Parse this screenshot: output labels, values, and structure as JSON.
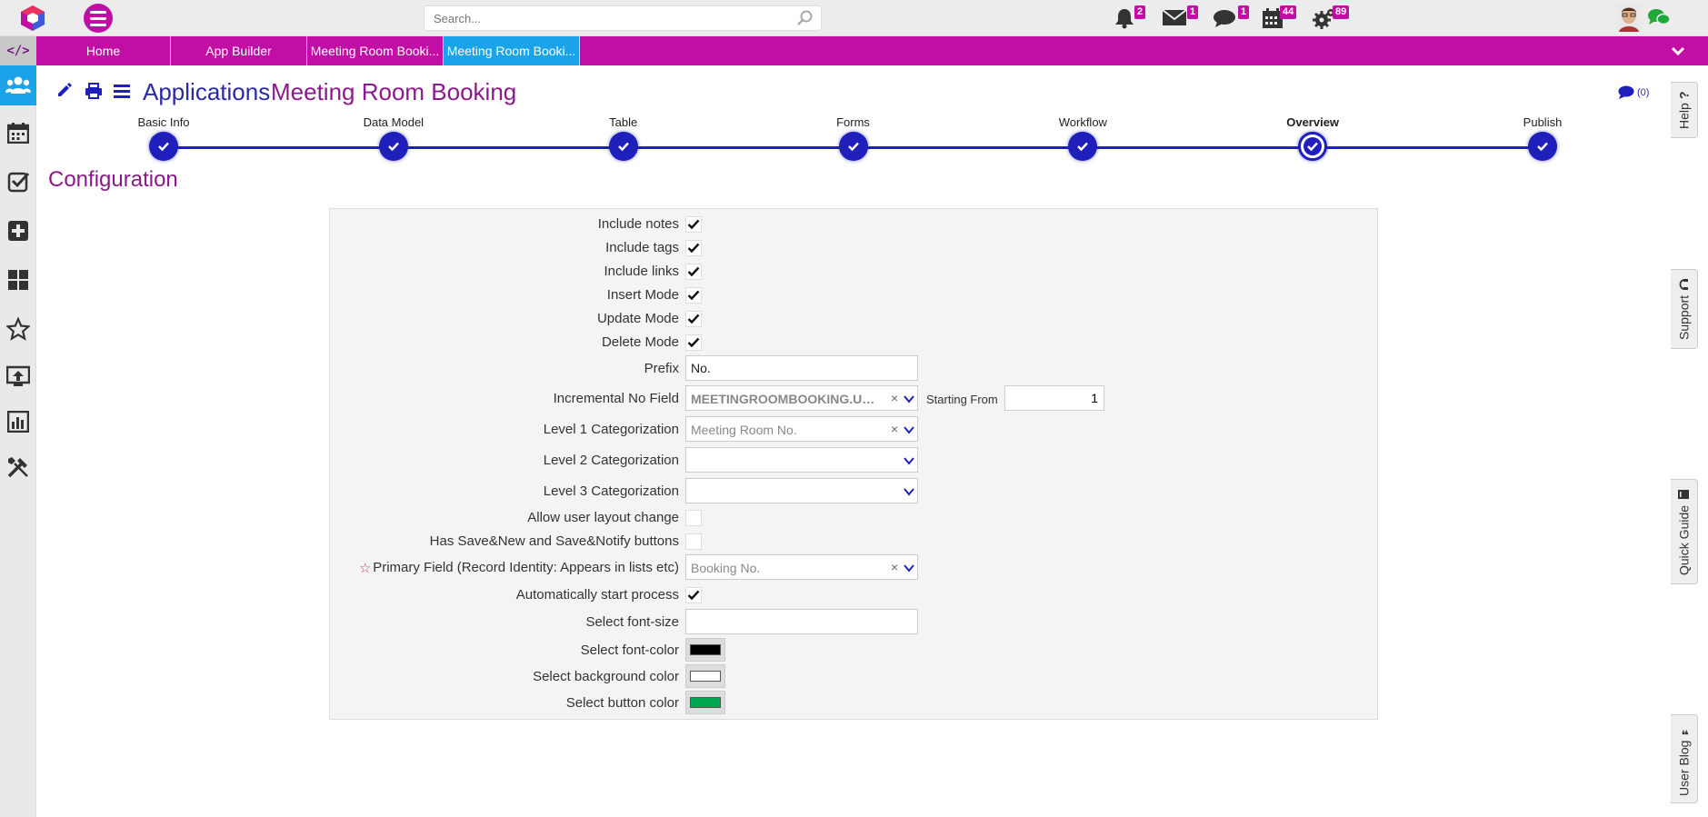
{
  "search": {
    "placeholder": "Search..."
  },
  "notifications": [
    {
      "name": "bell-icon",
      "count": "2"
    },
    {
      "name": "mail-icon",
      "count": "1"
    },
    {
      "name": "chat-icon",
      "count": "1"
    },
    {
      "name": "calendar-icon",
      "count": "44"
    },
    {
      "name": "gears-icon",
      "count": "89"
    }
  ],
  "tabs": {
    "code": "</>",
    "items": [
      "Home",
      "App Builder",
      "Meeting Room Booki...",
      "Meeting Room Booki..."
    ],
    "active_index": 3
  },
  "header": {
    "section": "Applications",
    "app_name": "Meeting Room Booking",
    "comments": "(0)"
  },
  "steps": [
    {
      "label": "Basic Info",
      "state": "done"
    },
    {
      "label": "Data Model",
      "state": "done"
    },
    {
      "label": "Table",
      "state": "done"
    },
    {
      "label": "Forms",
      "state": "done"
    },
    {
      "label": "Workflow",
      "state": "done"
    },
    {
      "label": "Overview",
      "state": "current"
    },
    {
      "label": "Publish",
      "state": "done"
    }
  ],
  "config_title": "Configuration",
  "config": {
    "include_notes": {
      "label": "Include notes",
      "checked": true
    },
    "include_tags": {
      "label": "Include tags",
      "checked": true
    },
    "include_links": {
      "label": "Include links",
      "checked": true
    },
    "insert_mode": {
      "label": "Insert Mode",
      "checked": true
    },
    "update_mode": {
      "label": "Update Mode",
      "checked": true
    },
    "delete_mode": {
      "label": "Delete Mode",
      "checked": true
    },
    "prefix": {
      "label": "Prefix",
      "value": "No."
    },
    "incremental": {
      "label": "Incremental No Field",
      "value": "MEETINGROOMBOOKING.USR_...",
      "clear": "×",
      "starting_label": "Starting From",
      "starting_value": "1"
    },
    "level1": {
      "label": "Level 1 Categorization",
      "value": "Meeting Room No.",
      "clear": "×"
    },
    "level2": {
      "label": "Level 2 Categorization",
      "value": ""
    },
    "level3": {
      "label": "Level 3 Categorization",
      "value": ""
    },
    "allow_layout": {
      "label": "Allow user layout change",
      "checked": false
    },
    "save_new": {
      "label": "Has Save&New and Save&Notify buttons",
      "checked": false
    },
    "primary_field": {
      "label": "Primary Field (Record Identity: Appears in lists etc)",
      "value": "Booking No.",
      "clear": "×",
      "required_mark": "☆"
    },
    "auto_start": {
      "label": "Automatically start process",
      "checked": true
    },
    "font_size": {
      "label": "Select font-size",
      "value": ""
    },
    "font_color": {
      "label": "Select font-color",
      "color": "#000000"
    },
    "bg_color": {
      "label": "Select background color",
      "color": "#ffffff"
    },
    "button_color": {
      "label": "Select button color",
      "color": "#00a64f"
    }
  },
  "right_tabs": {
    "help": "Help",
    "support": "Support",
    "quick_guide": "Quick Guide",
    "user_blog": "User Blog"
  },
  "colors": {
    "brand": "#c10fa5",
    "active_tab": "#1aa3e8",
    "stepper": "#1f1fbb",
    "title_blue": "#2a2aa8",
    "title_purple": "#8a1a8a"
  }
}
